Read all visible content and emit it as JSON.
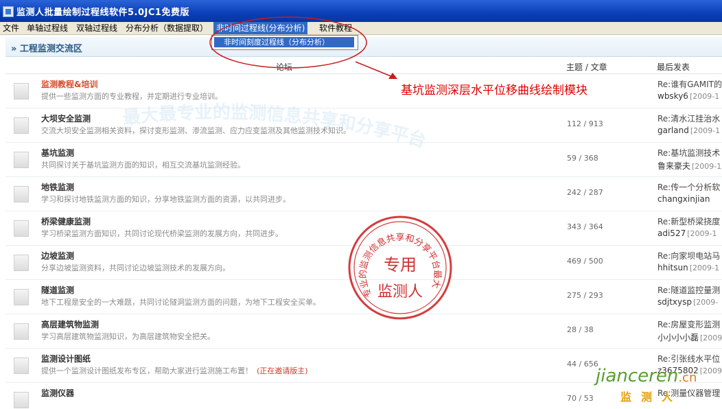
{
  "window": {
    "title": "监测人批量绘制过程线软件5.0JC1免费版"
  },
  "menu": [
    {
      "label": "文件"
    },
    {
      "label": "单轴过程线"
    },
    {
      "label": "双轴过程线"
    },
    {
      "label": "分布分析（数据提取）"
    },
    {
      "label": "非时间过程线(分布分析)"
    },
    {
      "label": "软件教程"
    }
  ],
  "dropdown": {
    "item": "非时间刻度过程线（分布分析）"
  },
  "annotation": {
    "text": "基坑监测深层水平位移曲线绘制模块"
  },
  "forum": {
    "section_title": "» 工程监测交流区",
    "columns": {
      "forum": "论坛",
      "topics": "主题 / 文章",
      "last_post": "最后发表"
    },
    "rows": [
      {
        "title": "监测教程&培训",
        "desc": "提供一些监测方面的专业教程，并定期进行专业培训。",
        "counts": "",
        "last_title": "Re:谁有GAMIT的",
        "last_user": "wbsky6",
        "last_date": "[2009-1"
      },
      {
        "title": "大坝安全监测",
        "desc": "交流大坝安全监测相关资料，探讨变形监测、渗流监测、应力应变监测及其他监测技术知识。",
        "counts": "112 / 913",
        "last_title": "Re:清水江挂治水",
        "last_user": "garland",
        "last_date": "[2009-1"
      },
      {
        "title": "基坑监测",
        "desc": "共同探讨关于基坑监测方面的知识，相互交流基坑监测经验。",
        "counts": "59 / 368",
        "last_title": "Re:基坑监测技术",
        "last_user": "鲁来豪夫",
        "last_date": "[2009-1"
      },
      {
        "title": "地铁监测",
        "desc": "学习和探讨地铁监测方面的知识，分享地铁监测方面的资源，以共同进步。",
        "counts": "242 / 287",
        "last_title": "Re:传一个分析软",
        "last_user": "changxinjian",
        "last_date": ""
      },
      {
        "title": "桥梁健康监测",
        "desc": "学习桥梁监测方面知识，共同讨论现代桥梁监测的发展方向，共同进步。",
        "counts": "343 / 364",
        "last_title": "Re:新型桥梁挠度",
        "last_user": "adi527",
        "last_date": "[2009-1"
      },
      {
        "title": "边坡监测",
        "desc": "分享边坡监测资料，共同讨论边坡监测技术的发展方向。",
        "counts": "469 / 500",
        "last_title": "Re:向家坝电站马",
        "last_user": "hhitsun",
        "last_date": "[2009-1"
      },
      {
        "title": "隧道监测",
        "desc": "地下工程是安全的一大难题，共同讨论隧洞监测方面的问题，为地下工程安全买单。",
        "counts": "275 / 293",
        "last_title": "Re:隧道监控量测",
        "last_user": "sdjtxysp",
        "last_date": "[2009-"
      },
      {
        "title": "高层建筑物监测",
        "desc": "学习高层建筑物监测知识，为高层建筑物安全把关。",
        "counts": "28 / 38",
        "last_title": "Re:房屋变形监测",
        "last_user": "小小小小磊",
        "last_date": "[2009"
      },
      {
        "title": "监测设计图纸",
        "desc": "提供一个监测设计图纸发布专区，帮助大家进行监测施工布置！",
        "invite": "(正在邀请版主)",
        "counts": "44 / 656",
        "last_title": "Re:引张线水平位",
        "last_user": "z3675802",
        "last_date": "[2009"
      },
      {
        "title": "监测仪器",
        "desc": "",
        "counts": "70 / 53",
        "last_title": "Re:测量仪器管理",
        "last_user": "",
        "last_date": ""
      }
    ]
  },
  "stamp": {
    "ring_text": "专业的监测信息共享和分享平台最大",
    "center_top": "专用",
    "center_bottom": "监测人"
  },
  "watermark": {
    "text": "最大最专业的监测信息共享和分享平台"
  },
  "logo": {
    "latin": "jianceren",
    "tld": ".cn",
    "cn": "监测人"
  },
  "colors": {
    "title_bar": "#0a3fb8",
    "menu_active": "#316ac5",
    "forum_red": "#d84a2c",
    "annotation": "#e00000",
    "stamp": "#cc1a1a",
    "logo_green": "#5aa02c"
  }
}
